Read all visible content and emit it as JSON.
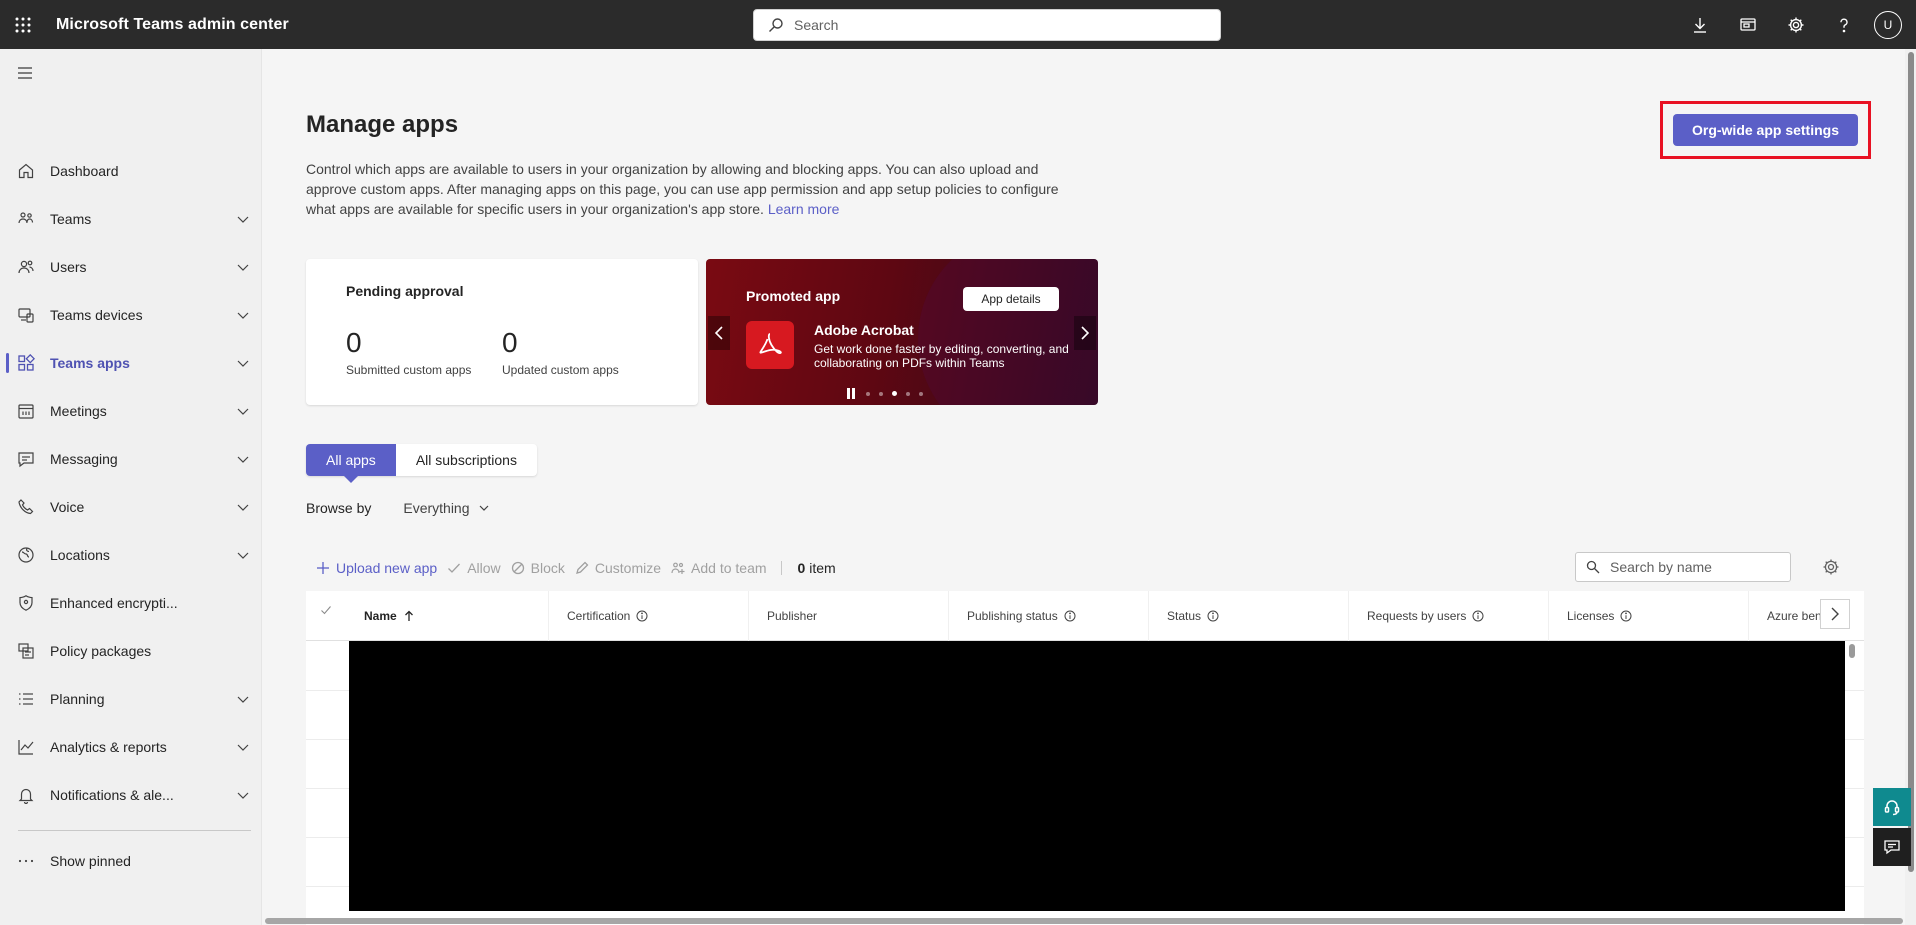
{
  "topbar": {
    "title": "Microsoft Teams admin center",
    "search_placeholder": "Search",
    "avatar_initial": "U"
  },
  "sidebar": {
    "items": [
      {
        "label": "Dashboard",
        "icon": "home-icon",
        "expandable": false
      },
      {
        "label": "Teams",
        "icon": "teams-icon",
        "expandable": true
      },
      {
        "label": "Users",
        "icon": "users-icon",
        "expandable": true
      },
      {
        "label": "Teams devices",
        "icon": "devices-icon",
        "expandable": true
      },
      {
        "label": "Teams apps",
        "icon": "apps-icon",
        "expandable": true,
        "active": true
      },
      {
        "label": "Meetings",
        "icon": "calendar-icon",
        "expandable": true
      },
      {
        "label": "Messaging",
        "icon": "chat-icon",
        "expandable": true
      },
      {
        "label": "Voice",
        "icon": "phone-icon",
        "expandable": true
      },
      {
        "label": "Locations",
        "icon": "globe-icon",
        "expandable": true
      },
      {
        "label": "Enhanced encrypti...",
        "icon": "shield-icon",
        "expandable": false
      },
      {
        "label": "Policy packages",
        "icon": "package-icon",
        "expandable": false
      },
      {
        "label": "Planning",
        "icon": "list-icon",
        "expandable": true
      },
      {
        "label": "Analytics & reports",
        "icon": "analytics-icon",
        "expandable": true
      },
      {
        "label": "Notifications & ale...",
        "icon": "bell-icon",
        "expandable": true
      }
    ],
    "show_pinned": "Show pinned"
  },
  "main": {
    "title": "Manage apps",
    "description": "Control which apps are available to users in your organization by allowing and blocking apps. You can also upload and approve custom apps. After managing apps on this page, you can use app permission and app setup policies to configure what apps are available for specific users in your organization's app store.",
    "learn_more": "Learn more",
    "org_button": "Org-wide app settings",
    "pending": {
      "title": "Pending approval",
      "submitted_value": "0",
      "submitted_label": "Submitted custom apps",
      "updated_value": "0",
      "updated_label": "Updated custom apps"
    },
    "promo": {
      "label": "Promoted app",
      "details_button": "App details",
      "app_name": "Adobe Acrobat",
      "app_desc": "Get work done faster by editing, converting, and collaborating on PDFs within Teams",
      "active_dot": 3,
      "dot_count": 5
    },
    "tabs": [
      "All apps",
      "All subscriptions"
    ],
    "browse_label": "Browse by",
    "browse_value": "Everything",
    "toolbar": {
      "upload": "Upload new app",
      "allow": "Allow",
      "block": "Block",
      "customize": "Customize",
      "add_to_team": "Add to team",
      "count_num": "0",
      "count_label": "item",
      "search_placeholder": "Search by name"
    },
    "columns": [
      "Name",
      "Certification",
      "Publisher",
      "Publishing status",
      "Status",
      "Requests by users",
      "Licenses",
      "Azure benefi"
    ]
  },
  "colors": {
    "accent": "#5b5fc7",
    "topbar": "#2b2b2b",
    "highlight_border": "#e81123",
    "promo_logo": "#d71920"
  }
}
